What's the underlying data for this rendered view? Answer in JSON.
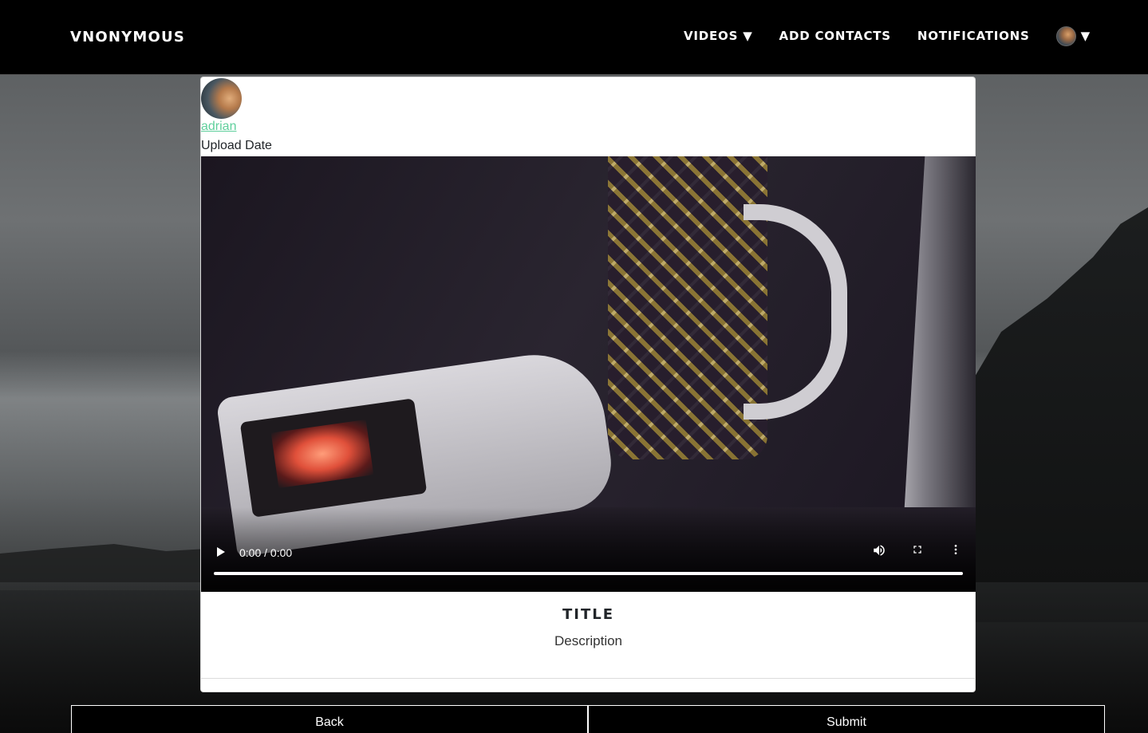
{
  "navbar": {
    "brand": "VNONYMOUS",
    "links": {
      "videos": "VIDEOS",
      "add_contacts": "ADD CONTACTS",
      "notifications": "NOTIFICATIONS"
    },
    "caret": "▼"
  },
  "post": {
    "author": "adrian",
    "upload_date_label": "Upload Date",
    "video": {
      "time": "0:00 / 0:00",
      "progress_fraction": 0
    },
    "title": "TITLE",
    "description": "Description"
  },
  "actions": {
    "back_label": "Back",
    "submit_label": "Submit"
  },
  "icons": {
    "play": "play-icon",
    "volume": "volume-icon",
    "fullscreen": "fullscreen-icon",
    "more": "more-vertical-icon"
  },
  "colors": {
    "navbar_bg": "#000000",
    "author_link": "#5fcf9c",
    "card_bg": "#ffffff",
    "button_bg": "#000000"
  }
}
